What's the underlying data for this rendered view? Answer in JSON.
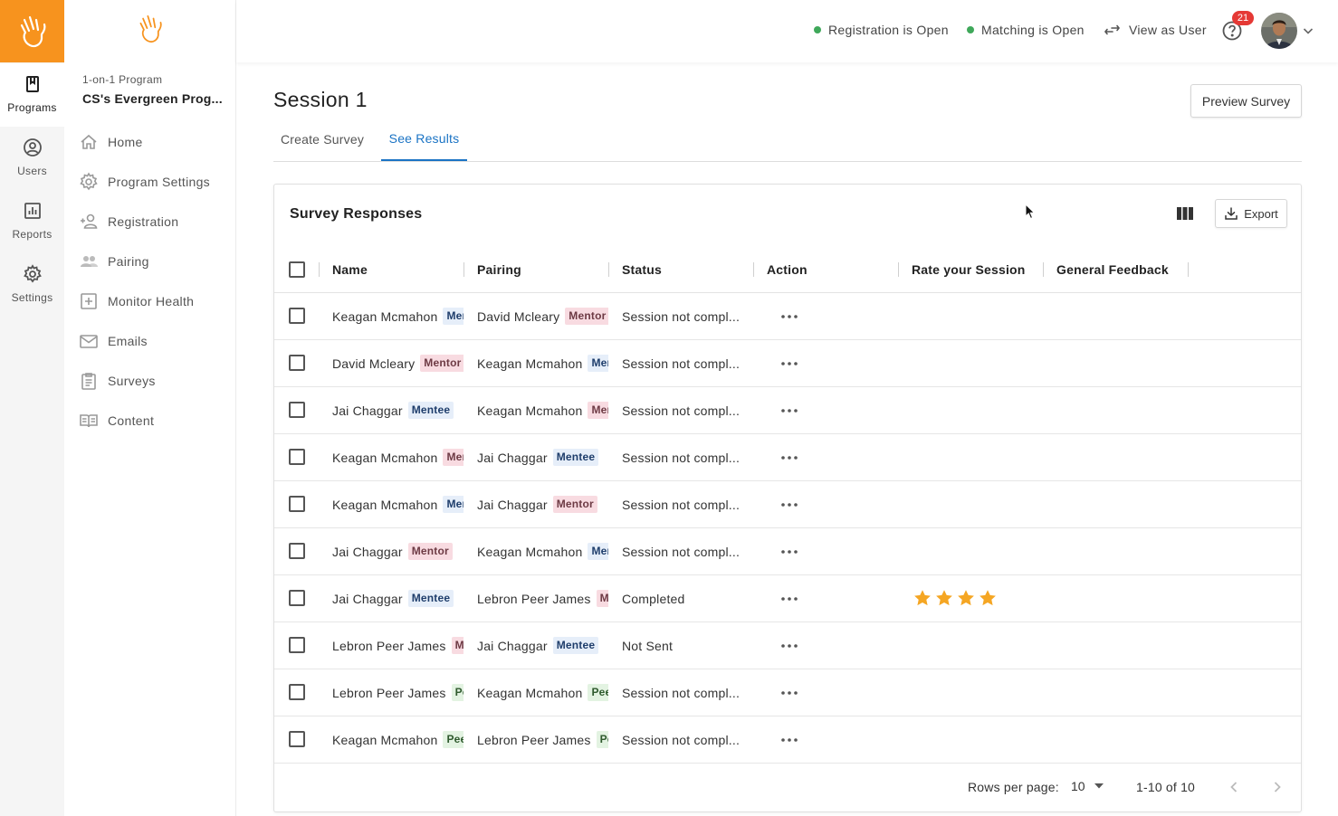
{
  "rail": {
    "items": [
      {
        "label": "Programs",
        "icon": "book-icon"
      },
      {
        "label": "Users",
        "icon": "user-circle-icon"
      },
      {
        "label": "Reports",
        "icon": "bar-chart-icon"
      },
      {
        "label": "Settings",
        "icon": "gear-icon"
      }
    ]
  },
  "nav": {
    "program_type": "1-on-1 Program",
    "program_name": "CS's Evergreen Prog...",
    "items": [
      {
        "label": "Home"
      },
      {
        "label": "Program Settings"
      },
      {
        "label": "Registration"
      },
      {
        "label": "Pairing"
      },
      {
        "label": "Monitor Health"
      },
      {
        "label": "Emails"
      },
      {
        "label": "Surveys"
      },
      {
        "label": "Content"
      }
    ]
  },
  "topbar": {
    "registration_status": "Registration is Open",
    "matching_status": "Matching is Open",
    "view_as_user": "View as User",
    "notification_count": "21",
    "status_color": "#3fa85a",
    "brand_color": "#f7931e"
  },
  "page": {
    "title": "Session 1",
    "preview_button": "Preview Survey",
    "tabs": [
      {
        "label": "Create Survey"
      },
      {
        "label": "See Results"
      }
    ]
  },
  "card": {
    "title": "Survey Responses",
    "export_label": "Export",
    "columns": [
      "Name",
      "Pairing",
      "Status",
      "Action",
      "Rate your Session",
      "General Feedback"
    ],
    "rows": [
      {
        "name": "Keagan Mcmahon",
        "name_tag": "Mentee",
        "pairing": "David Mcleary",
        "pairing_tag": "Mentor",
        "status": "Session not compl...",
        "rating": 0
      },
      {
        "name": "David Mcleary",
        "name_tag": "Mentor",
        "pairing": "Keagan Mcmahon",
        "pairing_tag": "Mentee",
        "status": "Session not compl...",
        "rating": 0
      },
      {
        "name": "Jai Chaggar",
        "name_tag": "Mentee",
        "pairing": "Keagan Mcmahon",
        "pairing_tag": "Mentor",
        "status": "Session not compl...",
        "rating": 0
      },
      {
        "name": "Keagan Mcmahon",
        "name_tag": "Mentor",
        "pairing": "Jai Chaggar",
        "pairing_tag": "Mentee",
        "status": "Session not compl...",
        "rating": 0
      },
      {
        "name": "Keagan Mcmahon",
        "name_tag": "Mentee",
        "pairing": "Jai Chaggar",
        "pairing_tag": "Mentor",
        "status": "Session not compl...",
        "rating": 0
      },
      {
        "name": "Jai Chaggar",
        "name_tag": "Mentor",
        "pairing": "Keagan Mcmahon",
        "pairing_tag": "Mentee",
        "status": "Session not compl...",
        "rating": 0
      },
      {
        "name": "Jai Chaggar",
        "name_tag": "Mentee",
        "pairing": "Lebron Peer James",
        "pairing_tag": "Mentor",
        "status": "Completed",
        "rating": 4
      },
      {
        "name": "Lebron Peer James",
        "name_tag": "Mentor",
        "pairing": "Jai Chaggar",
        "pairing_tag": "Mentee",
        "status": "Not Sent",
        "rating": 0
      },
      {
        "name": "Lebron Peer James",
        "name_tag": "Peer",
        "pairing": "Keagan Mcmahon",
        "pairing_tag": "Peer",
        "status": "Session not compl...",
        "rating": 0
      },
      {
        "name": "Keagan Mcmahon",
        "name_tag": "Peer",
        "pairing": "Lebron Peer James",
        "pairing_tag": "Peer",
        "status": "Session not compl...",
        "rating": 0
      }
    ],
    "rows_per_page_label": "Rows per page:",
    "rows_per_page_value": "10",
    "range": "1-10 of 10"
  }
}
